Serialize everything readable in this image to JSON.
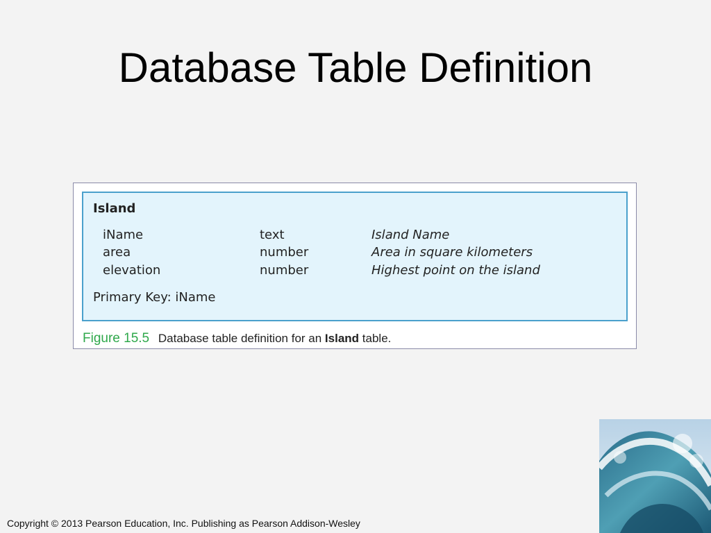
{
  "slide": {
    "title": "Database Table Definition"
  },
  "table": {
    "name": "Island",
    "fields": [
      {
        "name": "iName",
        "type": "text",
        "description": "Island Name"
      },
      {
        "name": "area",
        "type": "number",
        "description": "Area in square kilometers"
      },
      {
        "name": "elevation",
        "type": "number",
        "description": "Highest point on the island"
      }
    ],
    "primary_key": "Primary Key: iName"
  },
  "caption": {
    "label": "Figure 15.5",
    "text_before": "Database table definition for an",
    "text_strong": "Island",
    "text_after": "table."
  },
  "footer": {
    "copyright": "Copyright © 2013 Pearson Education, Inc. Publishing as Pearson Addison-Wesley"
  },
  "colors": {
    "figure_label": "#2fa84b",
    "table_fill": "#e3f4fc",
    "table_border": "#4aa0cc",
    "background": "#f3f3f3"
  }
}
